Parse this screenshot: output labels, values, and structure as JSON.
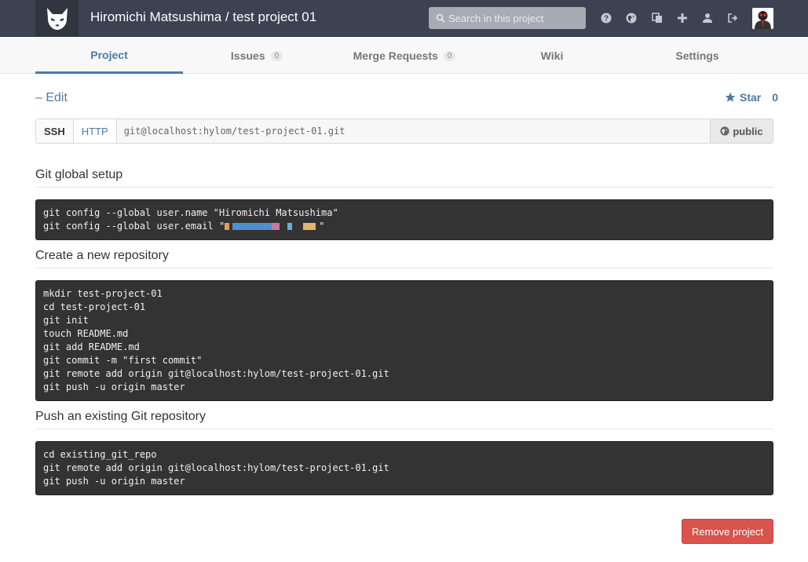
{
  "header": {
    "title": "Hiromichi Matsushima / test project 01",
    "search_placeholder": "Search in this project",
    "icons": [
      "question-icon",
      "globe-icon",
      "copy-icon",
      "plus-icon",
      "user-icon",
      "sign-out-icon"
    ]
  },
  "nav": {
    "tabs": [
      {
        "label": "Project",
        "active": true
      },
      {
        "label": "Issues",
        "count": "0"
      },
      {
        "label": "Merge Requests",
        "count": "0"
      },
      {
        "label": "Wiki"
      },
      {
        "label": "Settings"
      }
    ]
  },
  "project": {
    "edit_label": "– Edit",
    "star_label": "Star",
    "star_count": "0",
    "clone": {
      "ssh_label": "SSH",
      "http_label": "HTTP",
      "url": "git@localhost:hylom/test-project-01.git",
      "visibility": "public"
    }
  },
  "sections": {
    "global_setup": {
      "title": "Git global setup",
      "line1": "git config --global user.name \"Hiromichi Matsushima\"",
      "line2_prefix": "git config --global user.email \"",
      "line2_suffix": "\""
    },
    "new_repo": {
      "title": "Create a new repository",
      "code": "mkdir test-project-01\ncd test-project-01\ngit init\ntouch README.md\ngit add README.md\ngit commit -m \"first commit\"\ngit remote add origin git@localhost:hylom/test-project-01.git\ngit push -u origin master"
    },
    "existing_repo": {
      "title": "Push an existing Git repository",
      "code": "cd existing_git_repo\ngit remote add origin git@localhost:hylom/test-project-01.git\ngit push -u origin master"
    }
  },
  "actions": {
    "remove_label": "Remove project"
  },
  "colors": {
    "header_bg": "#3c4252",
    "link": "#4d7aa5",
    "danger": "#d9534f",
    "code_bg": "#333333"
  }
}
